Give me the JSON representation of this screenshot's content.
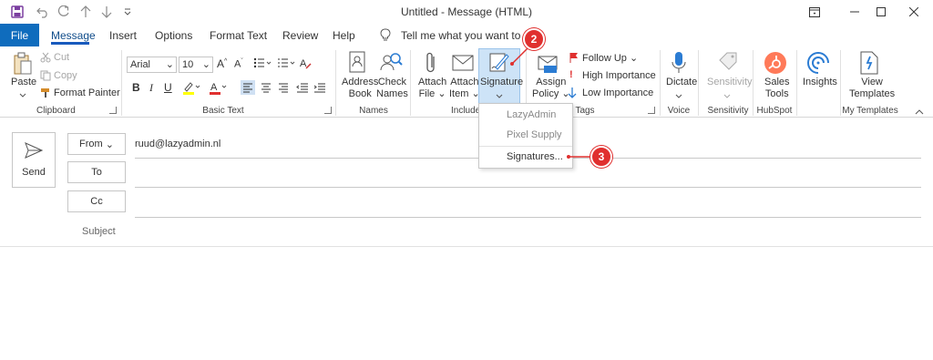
{
  "window": {
    "title": "Untitled  -  Message (HTML)",
    "controls": [
      "restore-ribbon",
      "minimize",
      "maximize",
      "close"
    ]
  },
  "tabs": {
    "file": "File",
    "items": [
      "Message",
      "Insert",
      "Options",
      "Format Text",
      "Review",
      "Help"
    ],
    "active": "Message",
    "tell_me": "Tell me what you want to do"
  },
  "ribbon": {
    "clipboard": {
      "label": "Clipboard",
      "paste": "Paste",
      "cut": "Cut",
      "copy": "Copy",
      "format_painter": "Format Painter"
    },
    "basic_text": {
      "label": "Basic Text",
      "font": "Arial",
      "size": "10",
      "bold": "B",
      "italic": "I",
      "underline": "U"
    },
    "names": {
      "label": "Names",
      "address_book": [
        "Address",
        "Book"
      ],
      "check_names": [
        "Check",
        "Names"
      ]
    },
    "include": {
      "label": "Include",
      "attach_file": [
        "Attach",
        "File"
      ],
      "attach_item": [
        "Attach",
        "Item"
      ],
      "signature": "Signature"
    },
    "tags": {
      "label": "Tags",
      "assign_policy": [
        "Assign",
        "Policy"
      ],
      "follow_up": "Follow Up",
      "high_importance": "High Importance",
      "low_importance": "Low Importance"
    },
    "voice": {
      "label": "Voice",
      "dictate": "Dictate"
    },
    "sensitivity": {
      "label": "Sensitivity",
      "button": "Sensitivity"
    },
    "hubspot": {
      "label": "HubSpot",
      "sales_tools": [
        "Sales",
        "Tools"
      ]
    },
    "insights": {
      "button": "Insights"
    },
    "templates": {
      "label": "My Templates",
      "view_templates": [
        "View",
        "Templates"
      ]
    }
  },
  "signature_menu": {
    "items": [
      "LazyAdmin",
      "Pixel Supply",
      "Signatures..."
    ]
  },
  "compose": {
    "send": "Send",
    "from_label": "From",
    "from_value": "ruud@lazyadmin.nl",
    "to_label": "To",
    "cc_label": "Cc",
    "subject_label": "Subject"
  },
  "callouts": [
    "2",
    "3"
  ],
  "colors": {
    "file_tab": "#0f6cbd",
    "callout": "#e0302f",
    "accent": "#185abd",
    "purple_save": "#7b3fa0"
  }
}
